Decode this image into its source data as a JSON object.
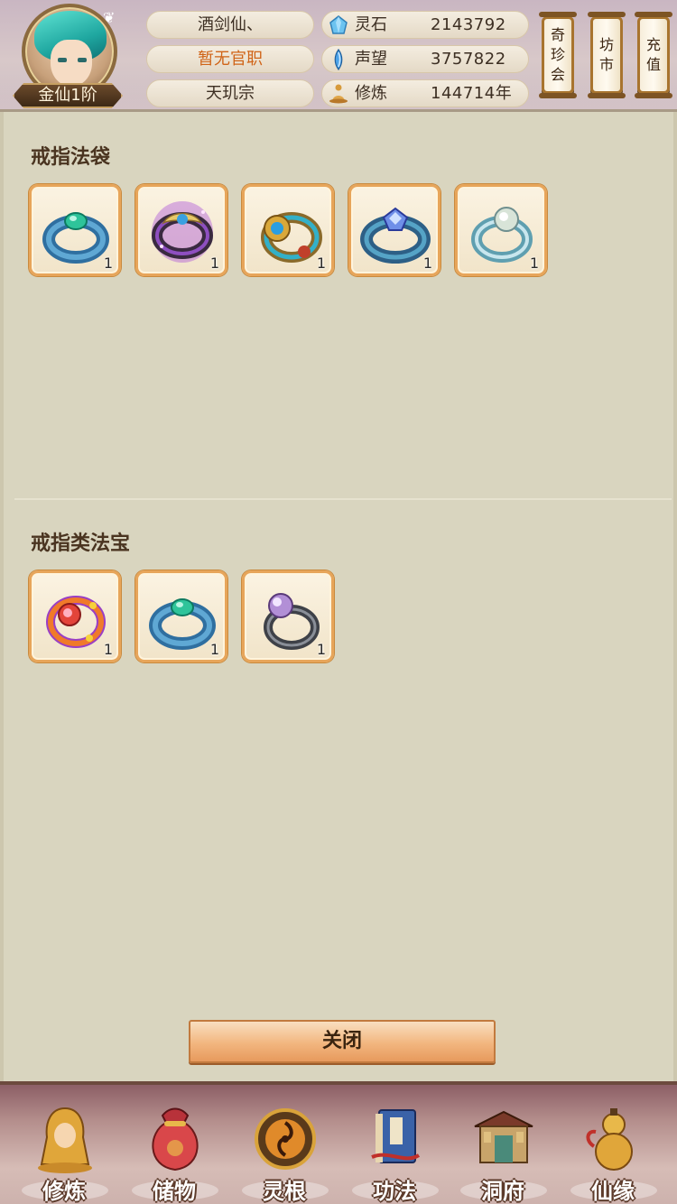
{
  "header": {
    "rank": "金仙1阶",
    "player_name": "酒剑仙、",
    "official_title": "暂无官职",
    "sect": "天玑宗",
    "stats": [
      {
        "label": "灵石",
        "value": "2143792",
        "icon": "spirit-stone-icon"
      },
      {
        "label": "声望",
        "value": "3757822",
        "icon": "reputation-crystal-icon"
      },
      {
        "label": "修炼",
        "value": "144714年",
        "icon": "meditation-icon"
      }
    ],
    "buttons": [
      {
        "lines": [
          "奇",
          "珍",
          "会"
        ]
      },
      {
        "lines": [
          "坊",
          "市"
        ]
      },
      {
        "lines": [
          "充",
          "值"
        ]
      }
    ]
  },
  "sections": [
    {
      "title": "戒指法袋",
      "items": [
        {
          "icon": "teal-ring-icon",
          "count": "1"
        },
        {
          "icon": "purple-dragon-ring-icon",
          "count": "1"
        },
        {
          "icon": "gold-gem-ring-icon",
          "count": "1"
        },
        {
          "icon": "blue-crystal-ring-icon",
          "count": "1"
        },
        {
          "icon": "pearl-ring-icon",
          "count": "1"
        }
      ]
    },
    {
      "title": "戒指类法宝",
      "items": [
        {
          "icon": "flame-ring-icon",
          "count": "1"
        },
        {
          "icon": "teal-ring-icon",
          "count": "1"
        },
        {
          "icon": "violet-pearl-ring-icon",
          "count": "1"
        }
      ]
    }
  ],
  "close_label": "关闭",
  "nav": [
    {
      "label": "修炼",
      "icon": "cultivator-icon"
    },
    {
      "label": "储物",
      "icon": "storage-bag-icon"
    },
    {
      "label": "灵根",
      "icon": "spirit-root-icon"
    },
    {
      "label": "功法",
      "icon": "scripture-book-icon"
    },
    {
      "label": "洞府",
      "icon": "cave-dwelling-icon"
    },
    {
      "label": "仙缘",
      "icon": "gourd-icon"
    }
  ],
  "colors": {
    "accent_orange": "#d06418",
    "slot_border": "#e7a55a",
    "panel_bg": "#d9d5bf"
  }
}
